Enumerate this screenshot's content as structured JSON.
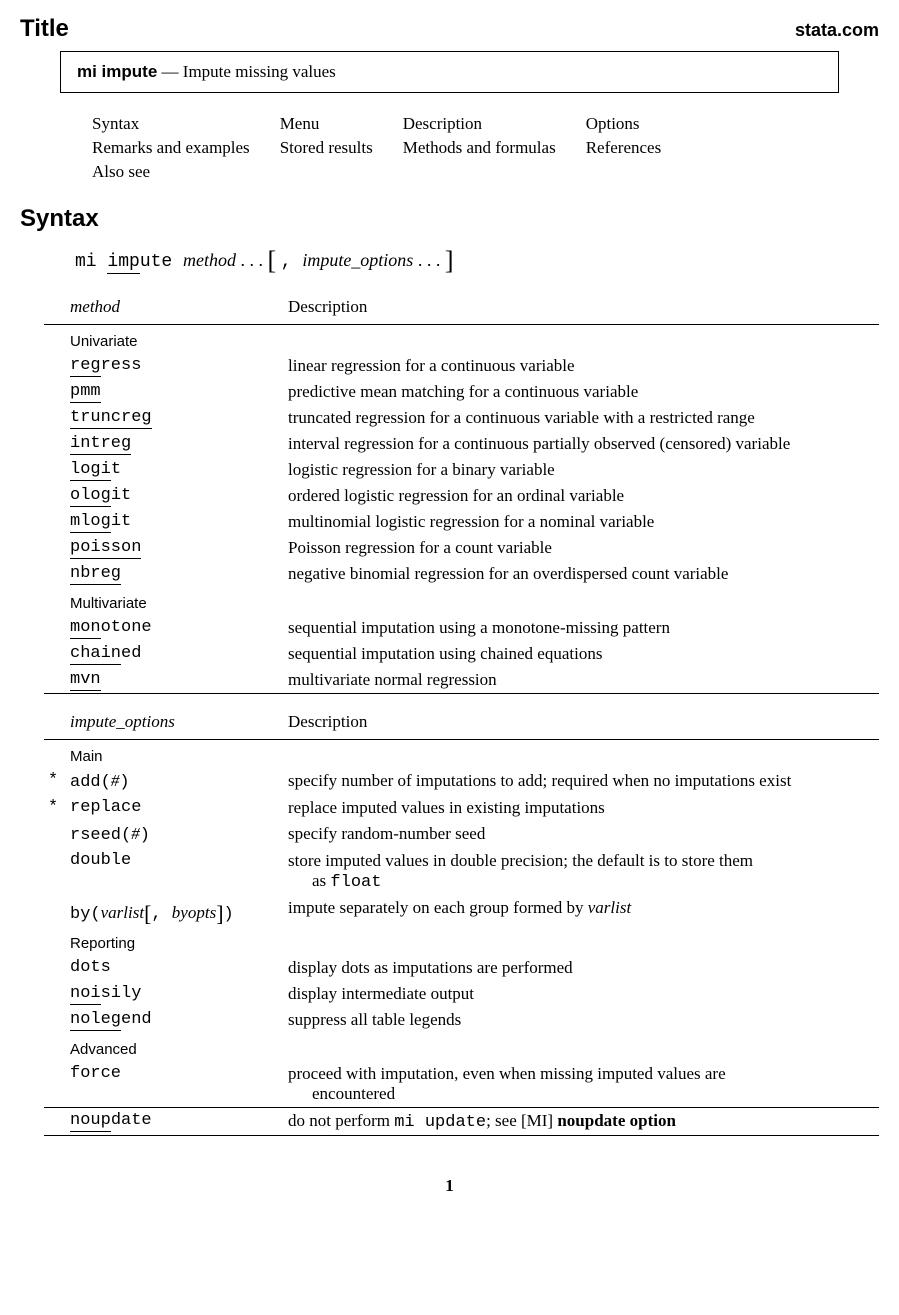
{
  "header": {
    "title": "Title",
    "site": "stata.com"
  },
  "titlebox": {
    "cmd": "mi impute",
    "dash": " — ",
    "desc": "Impute missing values"
  },
  "nav": [
    [
      "Syntax",
      "Menu",
      "Description",
      "Options"
    ],
    [
      "Remarks and examples",
      "Stored results",
      "Methods and formulas",
      "References"
    ],
    [
      "Also see",
      "",
      "",
      ""
    ]
  ],
  "syntax": {
    "heading": "Syntax",
    "pre": "mi ",
    "u1": "imp",
    "post1": "ute ",
    "method": "method",
    "dots1": " . . . ",
    "comma": ", ",
    "opts": "impute_options",
    "dots2": " . . . "
  },
  "table1": {
    "head_method": "method",
    "head_desc": "Description",
    "groups": [
      {
        "name": "Univariate",
        "rows": [
          {
            "u": "reg",
            "r": "ress",
            "desc": "linear regression for a continuous variable"
          },
          {
            "u": "pmm",
            "r": "",
            "desc": "predictive mean matching for a continuous variable"
          },
          {
            "u": "truncreg",
            "r": "",
            "desc": "truncated regression for a continuous variable with a restricted range"
          },
          {
            "u": "intreg",
            "r": "",
            "desc": "interval regression for a continuous partially observed (censored) variable"
          },
          {
            "u": "logi",
            "r": "t",
            "desc": "logistic regression for a binary variable"
          },
          {
            "u": "olog",
            "r": "it",
            "desc": "ordered logistic regression for an ordinal variable"
          },
          {
            "u": "mlog",
            "r": "it",
            "desc": "multinomial logistic regression for a nominal variable"
          },
          {
            "u": "poisson",
            "r": "",
            "desc": "Poisson regression for a count variable"
          },
          {
            "u": "nbreg",
            "r": "",
            "desc": "negative binomial regression for an overdispersed count variable"
          }
        ]
      },
      {
        "name": "Multivariate",
        "rows": [
          {
            "u": "mon",
            "r": "otone",
            "desc": "sequential imputation using a monotone-missing pattern"
          },
          {
            "u": "chain",
            "r": "ed",
            "desc": "sequential imputation using chained equations"
          },
          {
            "u": "mvn",
            "r": "",
            "desc": "multivariate normal regression"
          }
        ]
      }
    ]
  },
  "table2": {
    "head_method": "impute_options",
    "head_desc": "Description",
    "groups": [
      {
        "name": "Main",
        "rows": [
          {
            "star": "*",
            "m": "add(",
            "it": "#",
            "m2": ")",
            "desc": "specify number of imputations to add; required when no imputations exist"
          },
          {
            "star": "*",
            "m": "replace",
            "desc": "replace imputed values in existing imputations"
          },
          {
            "star": "",
            "m": "rseed(",
            "it": "#",
            "m2": ")",
            "desc": "specify random-number seed"
          },
          {
            "star": "",
            "m": "double",
            "desc_pre": "store imputed values in double precision; the default is to store them",
            "desc_hang": "as ",
            "desc_tt": "float"
          },
          {
            "star": "",
            "by_pre": "by(",
            "by_it1": "varlist",
            "by_mid": ", ",
            "by_it2": "byopts",
            "by_post": ")",
            "desc_pre": "impute separately on each group formed by ",
            "desc_it": "varlist"
          }
        ]
      },
      {
        "name": "Reporting",
        "rows": [
          {
            "star": "",
            "m": "dots",
            "desc": "display dots as imputations are performed"
          },
          {
            "star": "",
            "u": "noi",
            "r": "sily",
            "desc": "display intermediate output"
          },
          {
            "star": "",
            "u": "noleg",
            "r": "end",
            "desc": "suppress all table legends"
          }
        ]
      },
      {
        "name": "Advanced",
        "rows": [
          {
            "star": "",
            "m": "force",
            "desc_pre": "proceed with imputation, even when missing imputed values are",
            "desc_hang": "encountered"
          }
        ]
      }
    ],
    "noupdate": {
      "u": "noup",
      "r": "date",
      "d1": "do not perform ",
      "d2": "mi update",
      "d3": "; see [MI] ",
      "d4": "noupdate option"
    }
  },
  "pagenum": "1"
}
